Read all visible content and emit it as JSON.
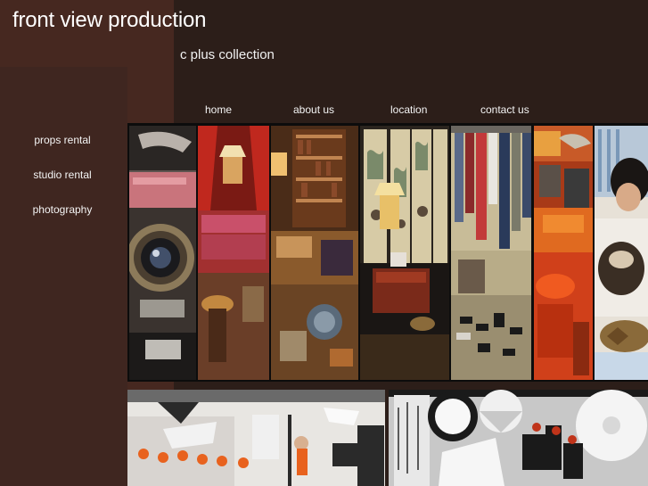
{
  "header": {
    "site_title": "front view production",
    "subtitle": "c plus collection"
  },
  "top_nav": [
    {
      "label": "home"
    },
    {
      "label": "about us"
    },
    {
      "label": "location"
    },
    {
      "label": "contact us"
    }
  ],
  "side_nav": [
    {
      "label": "props rental"
    },
    {
      "label": "studio rental"
    },
    {
      "label": "photography"
    }
  ],
  "images": {
    "collage": [
      {
        "subject": "vintage camera",
        "color": "#7a6a62"
      },
      {
        "subject": "red sofa",
        "color": "#b53a2a"
      },
      {
        "subject": "antique room",
        "color": "#8a5a2a"
      },
      {
        "subject": "chinese painted screen",
        "color": "#cdbf9a"
      },
      {
        "subject": "clothes rack",
        "color": "#c3b692"
      },
      {
        "subject": "orange chairs",
        "color": "#d64a16"
      },
      {
        "subject": "child with tortoise",
        "color": "#e7e1d7"
      }
    ],
    "studio": [
      {
        "subject": "studio shoot with orange stools",
        "color": "#eae6e2"
      },
      {
        "subject": "studio lighting umbrellas",
        "color": "#dcdad8"
      }
    ]
  },
  "colors": {
    "background": "#2c1e19",
    "left_panel": "#462820",
    "text": "#ffffff"
  }
}
